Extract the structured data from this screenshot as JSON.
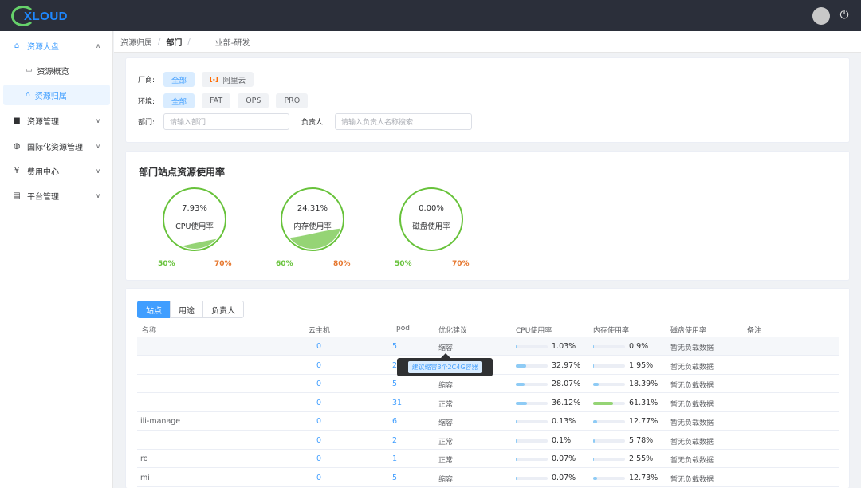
{
  "app": {
    "logo": "XLOUD"
  },
  "header": {
    "logout_icon": "logout-icon"
  },
  "sidebar": {
    "items": [
      {
        "label": "资源大盘",
        "icon": "home-icon"
      },
      {
        "label": "资源概览",
        "icon": "monitor-icon"
      },
      {
        "label": "资源归属",
        "icon": "house-icon"
      },
      {
        "label": "资源管理",
        "icon": "folder-icon"
      },
      {
        "label": "国际化资源管理",
        "icon": "globe-icon"
      },
      {
        "label": "费用中心",
        "icon": "yen-icon"
      },
      {
        "label": "平台管理",
        "icon": "screen-icon"
      }
    ]
  },
  "breadcrumb": {
    "first": "资源归属",
    "second": "部门",
    "third": "业部-研发"
  },
  "filters": {
    "vendor_label": "厂商:",
    "vendor_all": "全部",
    "vendor_aliyun": "阿里云",
    "env_label": "环境:",
    "env_options": [
      "全部",
      "FAT",
      "OPS",
      "PRO"
    ],
    "dept_label": "部门:",
    "dept_placeholder": "请输入部门",
    "owner_label": "负责人:",
    "owner_placeholder": "请输入负责人名称搜索"
  },
  "usage": {
    "title": "部门站点资源使用率",
    "gauges": [
      {
        "value": "7.93%",
        "label": "CPU使用率",
        "fill": 0.0793,
        "low": "50%",
        "high": "70%"
      },
      {
        "value": "24.31%",
        "label": "内存使用率",
        "fill": 0.2431,
        "low": "60%",
        "high": "80%"
      },
      {
        "value": "0.00%",
        "label": "磁盘使用率",
        "fill": 0,
        "low": "50%",
        "high": "70%"
      }
    ]
  },
  "table": {
    "tabs": [
      "站点",
      "用途",
      "负责人"
    ],
    "columns": [
      "名称",
      "云主机",
      "pod",
      "优化建议",
      "CPU使用率",
      "内存使用率",
      "磁盘使用率",
      "备注"
    ],
    "rows": [
      {
        "name": "",
        "vm": "0",
        "pod": "5",
        "suggestion": "缩容",
        "cpu": "1.03%",
        "cpu_fill": 0.0103,
        "mem": "0.9%",
        "mem_fill": 0.009,
        "disk": "暂无负载数据"
      },
      {
        "name": "",
        "vm": "0",
        "pod": "2",
        "suggestion": "",
        "cpu": "32.97%",
        "cpu_fill": 0.3297,
        "mem": "1.95%",
        "mem_fill": 0.0195,
        "disk": "暂无负载数据"
      },
      {
        "name": "",
        "vm": "0",
        "pod": "5",
        "suggestion": "缩容",
        "cpu": "28.07%",
        "cpu_fill": 0.2807,
        "mem": "18.39%",
        "mem_fill": 0.1839,
        "disk": "暂无负载数据"
      },
      {
        "name": "",
        "vm": "0",
        "pod": "31",
        "suggestion": "正常",
        "cpu": "36.12%",
        "cpu_fill": 0.3612,
        "mem": "61.31%",
        "mem_fill": 0.6131,
        "disk": "暂无负载数据"
      },
      {
        "name": "ili-manage",
        "vm": "0",
        "pod": "6",
        "suggestion": "缩容",
        "cpu": "0.13%",
        "cpu_fill": 0.0013,
        "mem": "12.77%",
        "mem_fill": 0.1277,
        "disk": "暂无负载数据"
      },
      {
        "name": "",
        "vm": "0",
        "pod": "2",
        "suggestion": "正常",
        "cpu": "0.1%",
        "cpu_fill": 0.001,
        "mem": "5.78%",
        "mem_fill": 0.0578,
        "disk": "暂无负载数据"
      },
      {
        "name": "ro",
        "vm": "0",
        "pod": "1",
        "suggestion": "正常",
        "cpu": "0.07%",
        "cpu_fill": 0.0007,
        "mem": "2.55%",
        "mem_fill": 0.0255,
        "disk": "暂无负载数据"
      },
      {
        "name": "mi",
        "vm": "0",
        "pod": "5",
        "suggestion": "缩容",
        "cpu": "0.07%",
        "cpu_fill": 0.0007,
        "mem": "12.73%",
        "mem_fill": 0.1273,
        "disk": "暂无负载数据"
      }
    ],
    "tooltip": "建议缩容3个2C4G容器"
  },
  "colors": {
    "accent": "#409eff",
    "gauge_green": "#67c23a",
    "warn": "#e6772e",
    "bar_cpu": "#8ecbf5",
    "bar_mem_high": "#95d475"
  }
}
